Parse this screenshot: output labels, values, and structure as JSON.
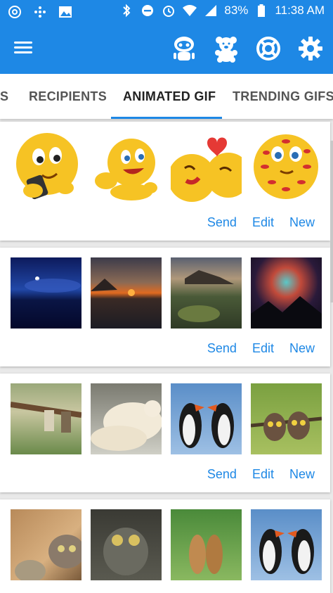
{
  "status_bar": {
    "battery": "83%",
    "time": "11:38 AM"
  },
  "app_bar": {
    "icons": [
      "menu-icon",
      "robot-icon",
      "teddy-bear-icon",
      "lifebuoy-icon",
      "gear-icon"
    ]
  },
  "tabs": [
    {
      "label": "S"
    },
    {
      "label": "RECIPIENTS"
    },
    {
      "label": "ANIMATED GIF"
    },
    {
      "label": "TRENDING GIFS"
    }
  ],
  "active_tab": "ANIMATED GIF",
  "cards": [
    {
      "thumbs": [
        "emoji-phone",
        "emoji-crawling",
        "emoji-kiss",
        "emoji-lipstick"
      ],
      "actions": {
        "send": "Send",
        "edit": "Edit",
        "new": "New"
      }
    },
    {
      "thumbs": [
        "night-lake",
        "sunset-lake",
        "rocky-coast",
        "nebula-mountains"
      ],
      "actions": {
        "send": "Send",
        "edit": "Edit",
        "new": "New"
      }
    },
    {
      "thumbs": [
        "couple-on-branch",
        "polar-bears",
        "puffins",
        "owlets-on-branch"
      ],
      "actions": {
        "send": "Send",
        "edit": "Edit",
        "new": "New"
      }
    },
    {
      "thumbs": [
        "cats-peeking",
        "owls",
        "prairie-dogs",
        "puffins"
      ]
    }
  ],
  "colors": {
    "primary": "#1e88e5",
    "action_text": "#1e88e5",
    "background": "#e9e9e9"
  }
}
